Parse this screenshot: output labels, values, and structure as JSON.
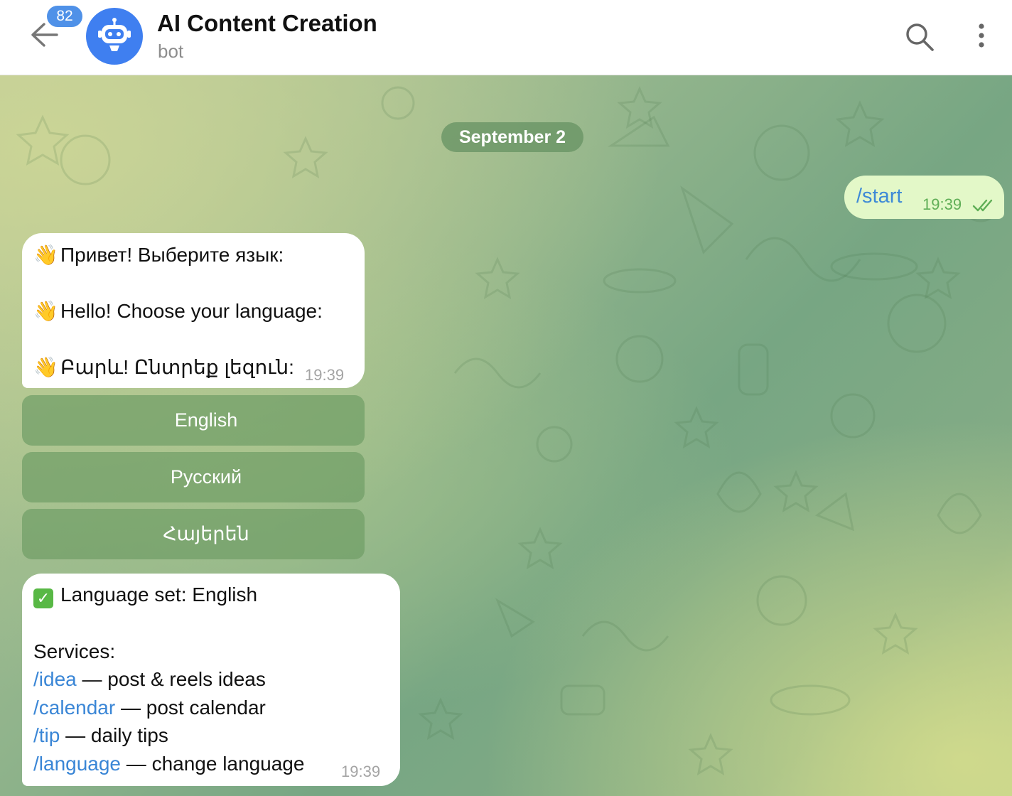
{
  "header": {
    "unread_count": "82",
    "title": "AI Content Creation",
    "subtitle": "bot",
    "back_icon": "arrow-left-icon",
    "search_icon": "search-icon",
    "more_icon": "more-vertical-icon",
    "avatar_icon": "robot-icon"
  },
  "chat": {
    "date_label": "September 2",
    "outgoing": {
      "text": "/start",
      "time": "19:39",
      "status_icon": "double-check-icon"
    },
    "greeting": {
      "lines": [
        "Привет! Выберите язык:",
        "Hello! Choose your language:",
        "Բարև! Ընտրեք լեզուն:"
      ],
      "emoji": "👋",
      "time": "19:39"
    },
    "language_buttons": [
      {
        "flag": "us",
        "label": "English"
      },
      {
        "flag": "ru",
        "label": "Русский"
      },
      {
        "flag": "am",
        "label": "Հայերեն"
      }
    ],
    "services": {
      "status_line": "Language set: English",
      "heading": "Services:",
      "items": [
        {
          "command": "/idea",
          "description": " — post & reels ideas"
        },
        {
          "command": "/calendar",
          "description": " — post calendar"
        },
        {
          "command": "/tip",
          "description": " — daily tips"
        },
        {
          "command": "/language",
          "description": " — change language"
        }
      ],
      "time": "19:39"
    }
  },
  "colors": {
    "accent": "#4f91e8",
    "link": "#3a86d6",
    "outgoing_bubble": "#e3f8c8",
    "outgoing_time": "#5fae56",
    "keyboard_button": "#709e66"
  }
}
